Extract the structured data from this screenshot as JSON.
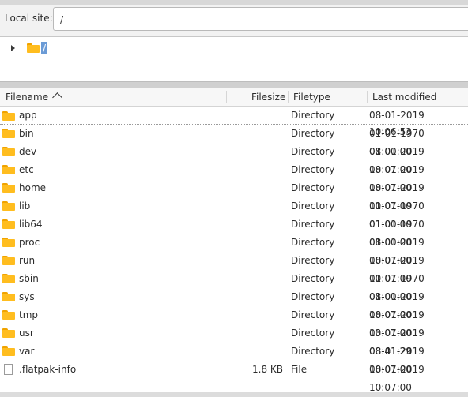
{
  "local_site": {
    "label": "Local site:",
    "path": "/"
  },
  "tree": {
    "root_label": "/"
  },
  "columns": {
    "filename": "Filename",
    "filesize": "Filesize",
    "filetype": "Filetype",
    "modified": "Last modified"
  },
  "rows": [
    {
      "name": "app",
      "size": "",
      "type": "Directory",
      "modified": "08-01-2019 10:06:53",
      "icon": "folder-icon"
    },
    {
      "name": "bin",
      "size": "",
      "type": "Directory",
      "modified": "01-01-1970 01:00:00",
      "icon": "folder-icon"
    },
    {
      "name": "dev",
      "size": "",
      "type": "Directory",
      "modified": "08-01-2019 10:07:00",
      "icon": "folder-icon"
    },
    {
      "name": "etc",
      "size": "",
      "type": "Directory",
      "modified": "08-01-2019 10:07:00",
      "icon": "folder-icon"
    },
    {
      "name": "home",
      "size": "",
      "type": "Directory",
      "modified": "08-01-2019 10:07:00",
      "icon": "folder-icon"
    },
    {
      "name": "lib",
      "size": "",
      "type": "Directory",
      "modified": "01-01-1970 01:00:00",
      "icon": "folder-icon"
    },
    {
      "name": "lib64",
      "size": "",
      "type": "Directory",
      "modified": "01-01-1970 01:00:00",
      "icon": "folder-icon"
    },
    {
      "name": "proc",
      "size": "",
      "type": "Directory",
      "modified": "08-01-2019 10:07:00",
      "icon": "folder-icon"
    },
    {
      "name": "run",
      "size": "",
      "type": "Directory",
      "modified": "08-01-2019 10:07:00",
      "icon": "folder-icon"
    },
    {
      "name": "sbin",
      "size": "",
      "type": "Directory",
      "modified": "01-01-1970 01:00:00",
      "icon": "folder-icon"
    },
    {
      "name": "sys",
      "size": "",
      "type": "Directory",
      "modified": "08-01-2019 10:07:00",
      "icon": "folder-icon"
    },
    {
      "name": "tmp",
      "size": "",
      "type": "Directory",
      "modified": "08-01-2019 10:07:00",
      "icon": "folder-icon"
    },
    {
      "name": "usr",
      "size": "",
      "type": "Directory",
      "modified": "03-01-2019 08:41:29",
      "icon": "folder-icon"
    },
    {
      "name": "var",
      "size": "",
      "type": "Directory",
      "modified": "08-01-2019 10:07:00",
      "icon": "folder-icon"
    },
    {
      "name": ".flatpak-info",
      "size": "1.8 KB",
      "type": "File",
      "modified": "08-01-2019 10:07:00",
      "icon": "file-icon"
    }
  ]
}
